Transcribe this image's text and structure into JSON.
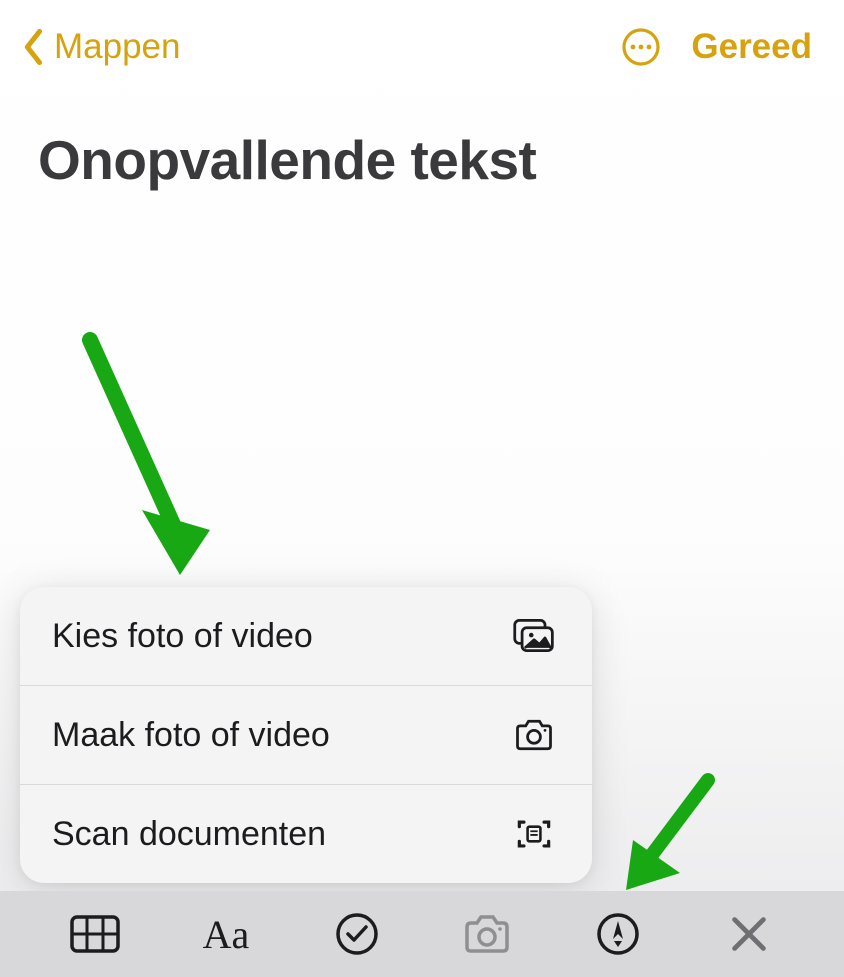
{
  "colors": {
    "accent": "#d6a20d",
    "annotation_arrow": "#17a814"
  },
  "header": {
    "back_label": "Mappen",
    "done_label": "Gereed"
  },
  "note": {
    "title": "Onopvallende tekst"
  },
  "popup": {
    "items": [
      {
        "label": "Kies foto of video",
        "icon": "photo-library-icon"
      },
      {
        "label": "Maak foto of video",
        "icon": "camera-icon"
      },
      {
        "label": "Scan documenten",
        "icon": "scan-document-icon"
      }
    ]
  },
  "toolbar": {
    "items": [
      {
        "name": "table-icon"
      },
      {
        "name": "text-format-icon",
        "label": "Aa"
      },
      {
        "name": "checklist-icon"
      },
      {
        "name": "camera-icon"
      },
      {
        "name": "markup-icon"
      },
      {
        "name": "close-icon"
      }
    ]
  }
}
